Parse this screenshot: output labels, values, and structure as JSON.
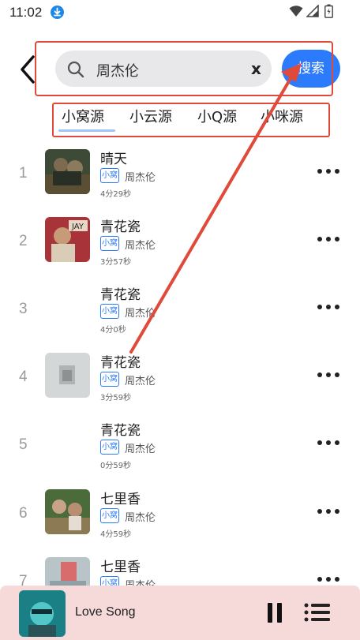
{
  "status_bar": {
    "time": "11:02"
  },
  "search": {
    "query": "周杰伦",
    "clear_label": "x",
    "button_label": "搜索"
  },
  "tabs": [
    {
      "label": "小窝源",
      "active": true
    },
    {
      "label": "小云源",
      "active": false
    },
    {
      "label": "小Q源",
      "active": false
    },
    {
      "label": "小咪源",
      "active": false
    }
  ],
  "songs": [
    {
      "index": "1",
      "title": "晴天",
      "tag": "小窝",
      "artist": "周杰伦",
      "duration": "4分29秒",
      "has_cover": true
    },
    {
      "index": "2",
      "title": "青花瓷",
      "tag": "小窝",
      "artist": "周杰伦",
      "duration": "3分57秒",
      "has_cover": true
    },
    {
      "index": "3",
      "title": "青花瓷",
      "tag": "小窝",
      "artist": "周杰伦",
      "duration": "4分0秒",
      "has_cover": false
    },
    {
      "index": "4",
      "title": "青花瓷",
      "tag": "小窝",
      "artist": "周杰伦",
      "duration": "3分59秒",
      "has_cover": true
    },
    {
      "index": "5",
      "title": "青花瓷",
      "tag": "小窝",
      "artist": "周杰伦",
      "duration": "0分59秒",
      "has_cover": false
    },
    {
      "index": "6",
      "title": "七里香",
      "tag": "小窝",
      "artist": "周杰伦",
      "duration": "4分59秒",
      "has_cover": true
    },
    {
      "index": "7",
      "title": "七里香",
      "tag": "小窝",
      "artist": "周杰伦",
      "duration": "",
      "has_cover": true
    }
  ],
  "player": {
    "title": "Love Song"
  },
  "colors": {
    "accent": "#2b7bfc",
    "annotation": "#e04a3a",
    "player_bg": "#f6d9d9"
  },
  "icons": [
    "download-icon",
    "wifi-icon",
    "signal-icon",
    "battery-icon",
    "back-icon",
    "search-icon",
    "more-icon",
    "pause-icon",
    "playlist-icon"
  ]
}
